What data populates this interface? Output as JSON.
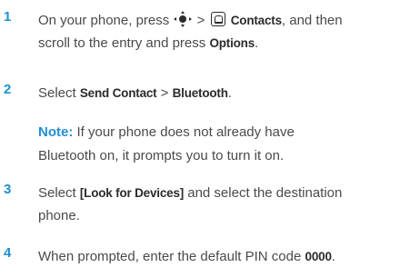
{
  "steps": [
    {
      "number": "1",
      "line1_before": "On your phone, press",
      "gt": ">",
      "contacts": "Contacts",
      "line1_after": ", and then",
      "line2_before": "scroll to the entry and press",
      "options": "Options",
      "line2_after": "."
    },
    {
      "number": "2",
      "before": "Select",
      "send_contact": "Send Contact",
      "gt": ">",
      "bluetooth": "Bluetooth",
      "after": "."
    },
    {
      "number": "3",
      "before": "Select",
      "look": "[Look for Devices]",
      "after_line1": "and select the destination",
      "line2": "phone."
    },
    {
      "number": "4",
      "before": "When prompted, enter the default PIN code",
      "pin": "0000",
      "after": "."
    }
  ],
  "note": {
    "label": "Note:",
    "line1": "If your phone does not already have",
    "line2": "Bluetooth on, it prompts you to turn it on."
  },
  "icons": [
    "nav-key-icon",
    "contacts-key-icon"
  ],
  "colors": {
    "accent": "#1f8fd0",
    "text": "#4a4a4a"
  }
}
